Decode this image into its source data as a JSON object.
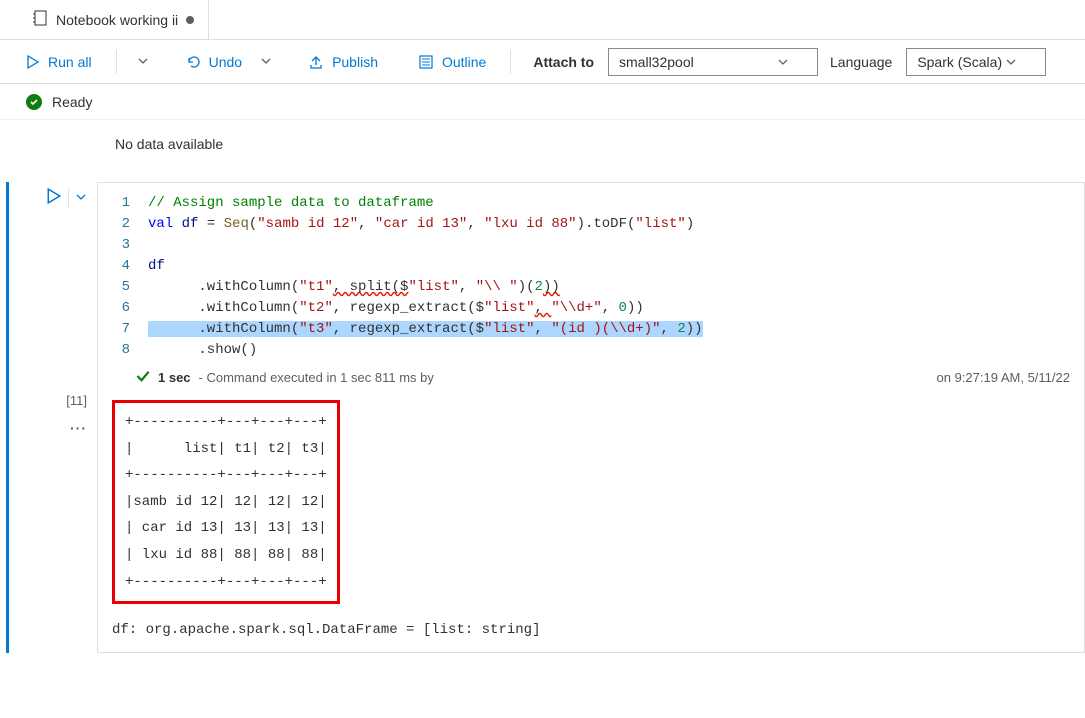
{
  "tab": {
    "title": "Notebook working ii",
    "dirty": true
  },
  "toolbar": {
    "run_all": "Run all",
    "undo": "Undo",
    "publish": "Publish",
    "outline": "Outline",
    "attach_label": "Attach to",
    "attach_value": "small32pool",
    "language_label": "Language",
    "language_value": "Spark (Scala)"
  },
  "status": {
    "text": "Ready"
  },
  "messages": {
    "no_data": "No data available"
  },
  "cell": {
    "number": "[11]",
    "lines": [
      "1",
      "2",
      "3",
      "4",
      "5",
      "6",
      "7",
      "8"
    ],
    "code": {
      "l1_comment": "// Assign sample data to dataframe",
      "l2_pre": "val df = Seq(",
      "l2_s1": "\"samb id 12\"",
      "l2_s2": "\"car id 13\"",
      "l2_s3": "\"lxu id 88\"",
      "l2_mid": ").toDF(",
      "l2_s4": "\"list\"",
      "l2_end": ")",
      "l4": "df",
      "l5_pre": "      .withColumn(",
      "l5_s1": "\"t1\"",
      "l5_mid1": ", split($",
      "l5_s2": "\"list\"",
      "l5_mid2": ", ",
      "l5_s3": "\"\\\\ \"",
      "l5_mid3": ")(",
      "l5_n": "2",
      "l5_end": "))",
      "l6_pre": "      .withColumn(",
      "l6_s1": "\"t2\"",
      "l6_mid1": ", regexp_extract($",
      "l6_s2": "\"list\"",
      "l6_mid2": ", ",
      "l6_s3": "\"\\\\d+\"",
      "l6_mid3": ", ",
      "l6_n": "0",
      "l6_end": "))",
      "l7_pre": "      .withColumn(",
      "l7_s1": "\"t3\"",
      "l7_mid1": ", regexp_extract($",
      "l7_s2": "\"list\"",
      "l7_mid2": ", ",
      "l7_s3": "\"(id )(\\\\d+)\"",
      "l7_mid3": ", ",
      "l7_n": "2",
      "l7_end": "))",
      "l8": "      .show()"
    },
    "exec": {
      "duration_short": "1 sec",
      "detail_prefix": " - Command executed in 1 sec 811 ms by",
      "timestamp": "on 9:27:19 AM, 5/11/22"
    },
    "output_table": "+----------+---+---+---+\n|      list| t1| t2| t3|\n+----------+---+---+---+\n|samb id 12| 12| 12| 12|\n| car id 13| 13| 13| 13|\n| lxu id 88| 88| 88| 88|\n+----------+---+---+---+",
    "df_type": "df: org.apache.spark.sql.DataFrame = [list: string]"
  }
}
